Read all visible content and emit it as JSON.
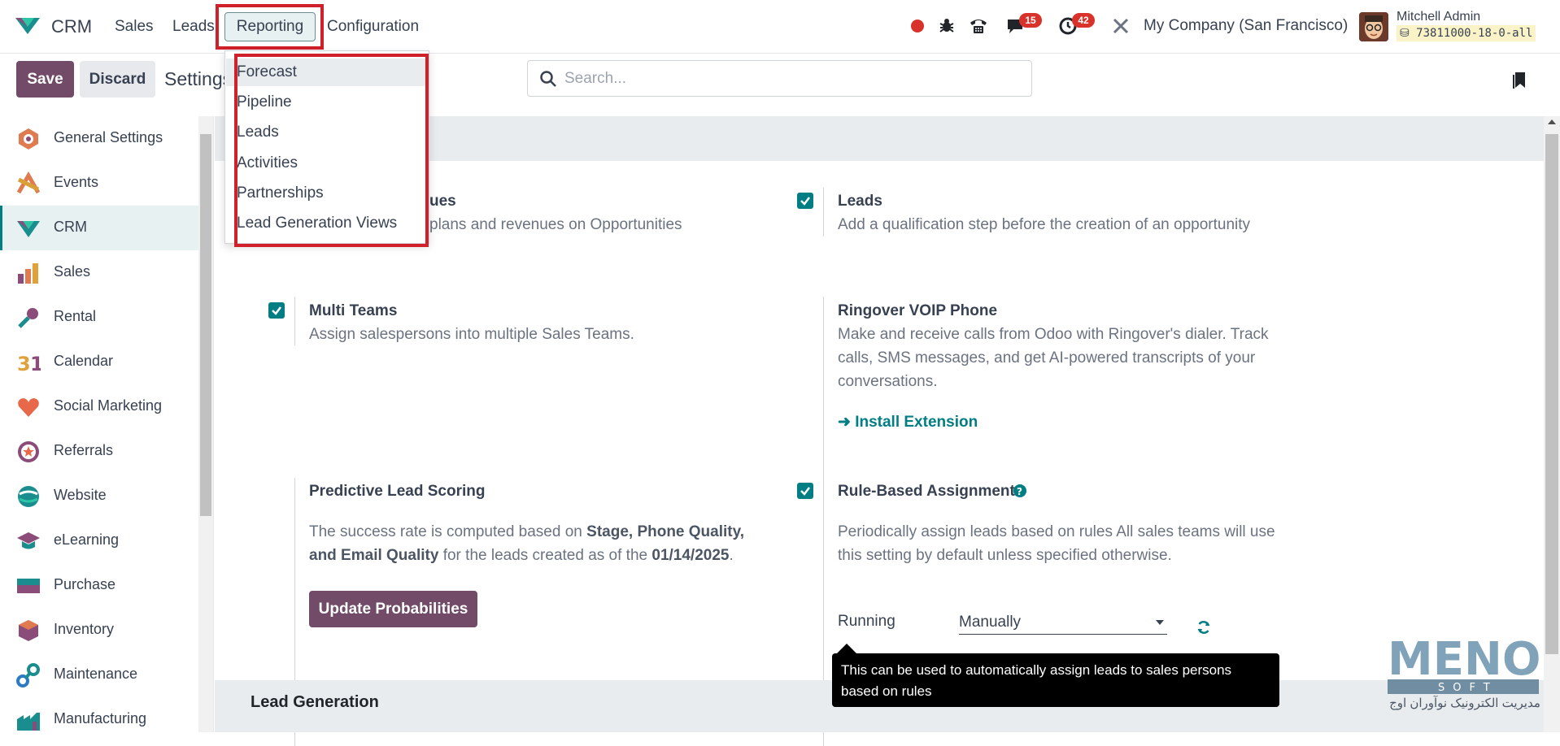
{
  "navbar": {
    "brand": "CRM",
    "menu": [
      "Sales",
      "Leads",
      "Reporting",
      "Configuration"
    ],
    "messages_badge": "15",
    "activities_badge": "42",
    "company": "My Company (San Francisco)",
    "user": "Mitchell Admin",
    "database": "73811000-18-0-all"
  },
  "control": {
    "save": "Save",
    "discard": "Discard",
    "title": "Settings",
    "search_placeholder": "Search..."
  },
  "reporting_menu": [
    "Forecast",
    "Pipeline",
    "Leads",
    "Activities",
    "Partnerships",
    "Lead Generation Views"
  ],
  "sidebar": {
    "items": [
      {
        "label": "General Settings",
        "icon": "general-settings-icon"
      },
      {
        "label": "Events",
        "icon": "events-icon"
      },
      {
        "label": "CRM",
        "icon": "crm-icon",
        "active": true
      },
      {
        "label": "Sales",
        "icon": "sales-icon"
      },
      {
        "label": "Rental",
        "icon": "rental-icon"
      },
      {
        "label": "Calendar",
        "icon": "calendar-icon"
      },
      {
        "label": "Social Marketing",
        "icon": "social-marketing-icon"
      },
      {
        "label": "Referrals",
        "icon": "referrals-icon"
      },
      {
        "label": "Website",
        "icon": "website-icon"
      },
      {
        "label": "eLearning",
        "icon": "elearning-icon"
      },
      {
        "label": "Purchase",
        "icon": "purchase-icon"
      },
      {
        "label": "Inventory",
        "icon": "inventory-icon"
      },
      {
        "label": "Maintenance",
        "icon": "maintenance-icon"
      },
      {
        "label": "Manufacturing",
        "icon": "manufacturing-icon"
      }
    ]
  },
  "settings": {
    "recurring_title_partial": "ues",
    "recurring_desc_partial": "plans and revenues on Opportunities",
    "leads_title": "Leads",
    "leads_desc": "Add a qualification step before the creation of an opportunity",
    "multi_teams_title": "Multi Teams",
    "multi_teams_desc": "Assign salespersons into multiple Sales Teams.",
    "ringover_title": "Ringover VOIP Phone",
    "ringover_desc": "Make and receive calls from Odoo with Ringover's dialer. Track calls, SMS messages, and get AI-powered transcripts of your conversations.",
    "install_extension": "Install Extension",
    "predictive_title": "Predictive Lead Scoring",
    "predictive_desc_1": "The success rate is computed based on ",
    "predictive_desc_bold_1": "Stage, Phone Quality, and Email Quality",
    "predictive_desc_2": " for the leads created as of the ",
    "predictive_date": "01/14/2025",
    "predictive_desc_3": ".",
    "update_button": "Update Probabilities",
    "rule_title": "Rule-Based Assignment",
    "rule_desc": "Periodically assign leads based on rules All sales teams will use this setting by default unless specified otherwise.",
    "running_label": "Running",
    "running_value": "Manually",
    "tooltip": "This can be used to automatically assign leads to sales persons based on rules",
    "lead_generation_section": "Lead Generation"
  },
  "watermark": {
    "logo_text": "MENO",
    "sub_text": "SOFT",
    "caption": "مدیریت الکترونیک نوآوران اوج"
  },
  "colors": {
    "primary": "#714b67",
    "accent": "#017e84",
    "highlight_frame": "#d0202a"
  }
}
